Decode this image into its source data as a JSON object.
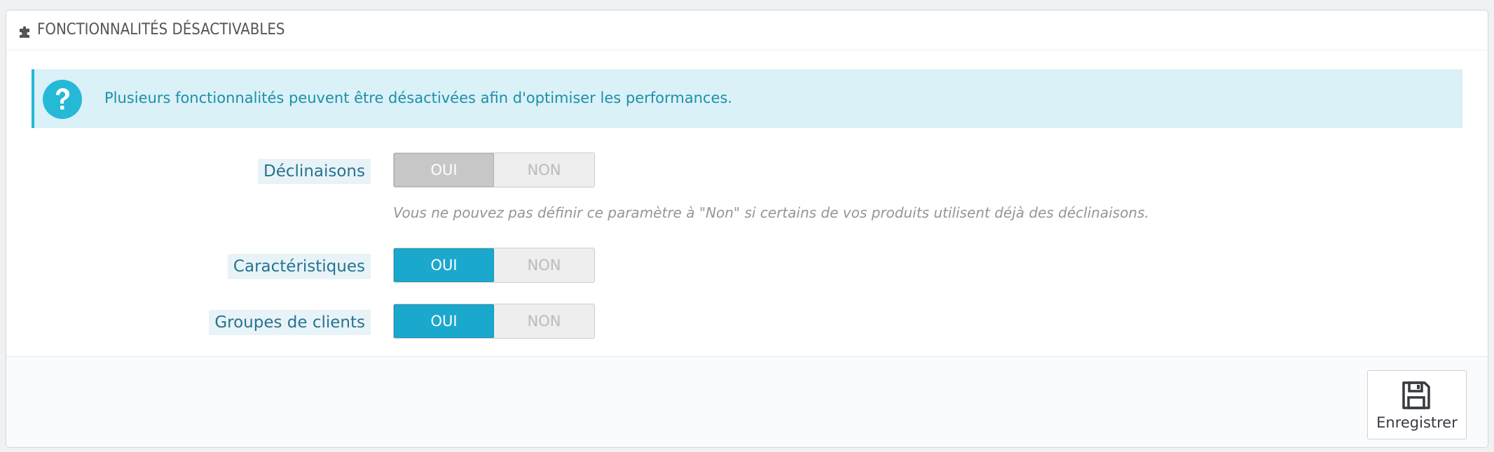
{
  "panel": {
    "title": "FONCTIONNALITÉS DÉSACTIVABLES",
    "heading_icon": "puzzle-icon"
  },
  "alert": {
    "icon": "question-icon",
    "text": "Plusieurs fonctionnalités peuvent être désactivées afin d'optimiser les performances."
  },
  "features": [
    {
      "label": "Déclinaisons",
      "yes": "OUI",
      "no": "NON",
      "selected": "OUI",
      "state": "disabled",
      "help": "Vous ne pouvez pas définir ce paramètre à \"Non\" si certains de vos produits utilisent déjà des déclinaisons."
    },
    {
      "label": "Caractéristiques",
      "yes": "OUI",
      "no": "NON",
      "selected": "OUI",
      "state": "enabled"
    },
    {
      "label": "Groupes de clients",
      "yes": "OUI",
      "no": "NON",
      "selected": "OUI",
      "state": "enabled"
    }
  ],
  "footer": {
    "save_label": "Enregistrer",
    "save_icon": "floppy-disk-icon"
  },
  "colors": {
    "accent": "#25b9d7",
    "switch_active": "#1ba8cd",
    "switch_disabled": "#c7c7c7",
    "alert_bg": "#d9f1f7"
  }
}
